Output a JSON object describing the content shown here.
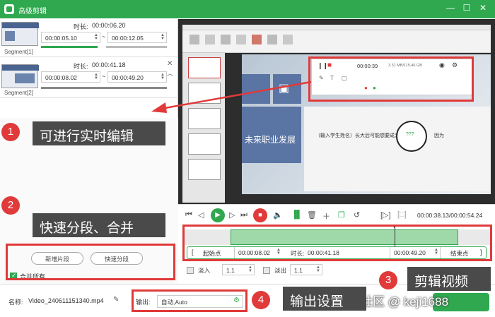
{
  "window": {
    "title": "高级剪辑"
  },
  "segments": [
    {
      "label": "Segment[1]",
      "duration_label": "时长:",
      "duration": "00:00:06.20",
      "start": "00:00:05.10",
      "end": "00:00:12.05"
    },
    {
      "label": "Segment[2]",
      "duration_label": "时长:",
      "duration": "00:00:41.18",
      "start": "00:00:08.02",
      "end": "00:00:49.20"
    }
  ],
  "tilde": "~",
  "left_buttons": {
    "new_segment": "新增片段",
    "quick_split": "快速分段",
    "merge_all": "合并所有"
  },
  "callouts": [
    {
      "num": "1",
      "text": "可进行实时编辑"
    },
    {
      "num": "2",
      "text": "快速分段、合并"
    },
    {
      "num": "3",
      "text": "剪辑视频"
    },
    {
      "num": "4",
      "text": "输出设置"
    }
  ],
  "preview": {
    "slide_title": "未来职业发展",
    "slide_text": "（输入学生姓名）长大后可能想要成为",
    "slide_circle": "???",
    "slide_word": "因为",
    "rec_time": "00:00:39",
    "rec_info": "3.31 MB/115.46 GB"
  },
  "transport": {
    "time": "00:00:38.13/00:00:54.24"
  },
  "timeline": {
    "start_label": "起始点",
    "start_time": "00:00:08.02",
    "duration_label": "时长:",
    "duration": "00:00:41.18",
    "end_time": "00:00:49.20",
    "end_label": "结束点",
    "fade_in": "淡入",
    "fade_in_val": "1.1",
    "fade_out": "淡出",
    "fade_out_val": "1.1"
  },
  "bottom": {
    "name_label": "名称:",
    "filename": "Video_240611151340.mp4",
    "output_label": "输出:",
    "output_value": "自动,Auto",
    "watermark": "掘金技术社区 @ keji1688"
  }
}
